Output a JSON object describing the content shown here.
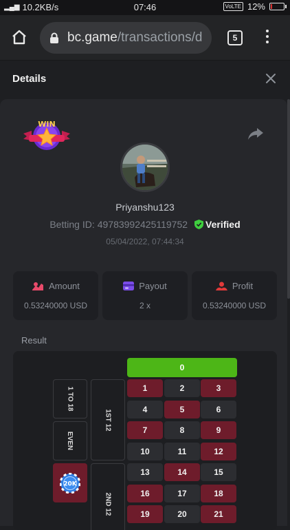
{
  "status_bar": {
    "network_speed": "10.2KB/s",
    "time": "07:46",
    "volte": "VoLTE",
    "battery": "12%",
    "battery_level": 0.12
  },
  "browser": {
    "url_host": "bc.game",
    "url_path": "/transactions/d",
    "tab_count": "5"
  },
  "modal": {
    "title": "Details"
  },
  "bet": {
    "badge_text": "WIN",
    "username": "Priyanshu123",
    "betting_id_label": "Betting ID:",
    "betting_id": "49783992425119752",
    "verified_label": "Verified",
    "datetime": "05/04/2022, 07:44:34"
  },
  "stats": {
    "amount_label": "Amount",
    "amount_value": "0.53240000 USD",
    "payout_label": "Payout",
    "payout_value": "2 x",
    "profit_label": "Profit",
    "profit_value": "0.53240000 USD"
  },
  "result": {
    "label": "Result",
    "zero": "0",
    "side_bets": [
      "1 TO 18",
      "EVEN"
    ],
    "dozens": [
      "1ST 12",
      "2ND 12"
    ],
    "chip_value": "20K",
    "rows": [
      [
        {
          "n": "1",
          "c": "red"
        },
        {
          "n": "2",
          "c": "dark"
        },
        {
          "n": "3",
          "c": "red"
        }
      ],
      [
        {
          "n": "4",
          "c": "dark"
        },
        {
          "n": "5",
          "c": "red"
        },
        {
          "n": "6",
          "c": "dark"
        }
      ],
      [
        {
          "n": "7",
          "c": "red"
        },
        {
          "n": "8",
          "c": "dark"
        },
        {
          "n": "9",
          "c": "red"
        }
      ],
      [
        {
          "n": "10",
          "c": "dark"
        },
        {
          "n": "11",
          "c": "dark"
        },
        {
          "n": "12",
          "c": "red"
        }
      ],
      [
        {
          "n": "13",
          "c": "dark"
        },
        {
          "n": "14",
          "c": "red"
        },
        {
          "n": "15",
          "c": "dark"
        }
      ],
      [
        {
          "n": "16",
          "c": "red"
        },
        {
          "n": "17",
          "c": "dark"
        },
        {
          "n": "18",
          "c": "red"
        }
      ],
      [
        {
          "n": "19",
          "c": "red"
        },
        {
          "n": "20",
          "c": "dark"
        },
        {
          "n": "21",
          "c": "red"
        }
      ]
    ]
  },
  "colors": {
    "red": "#6e1c2b",
    "green": "#4db617",
    "verified_green": "#3fcf3f"
  }
}
